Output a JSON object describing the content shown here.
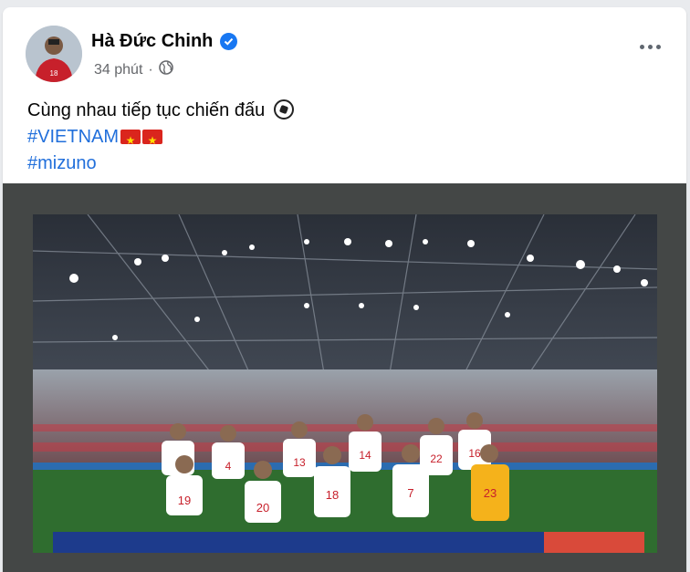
{
  "post": {
    "author": "Hà Đức Chinh",
    "time": "34 phút",
    "privacy_icon": "globe-icon",
    "verified_icon": "verified-badge-icon",
    "more_icon": "more-options-icon",
    "caption": "Cùng nhau tiếp tục chiến đấu",
    "hashtag_vietnam": "#VIETNAM",
    "hashtag_mizuno": "#mizuno",
    "caption_emoji": "soccer-ball-icon",
    "flag_emoji": "vietnam-flag-icon"
  },
  "photo": {
    "numbers_back_row": [
      "4",
      "13",
      "14",
      "22",
      "16"
    ],
    "numbers_front_row": [
      "19",
      "20",
      "18",
      "7",
      "23"
    ]
  },
  "colors": {
    "link": "#216fdb",
    "meta": "#65676b",
    "verified": "#1877f2",
    "jersey": "#ffffff",
    "keeper": "#f5b21b"
  }
}
